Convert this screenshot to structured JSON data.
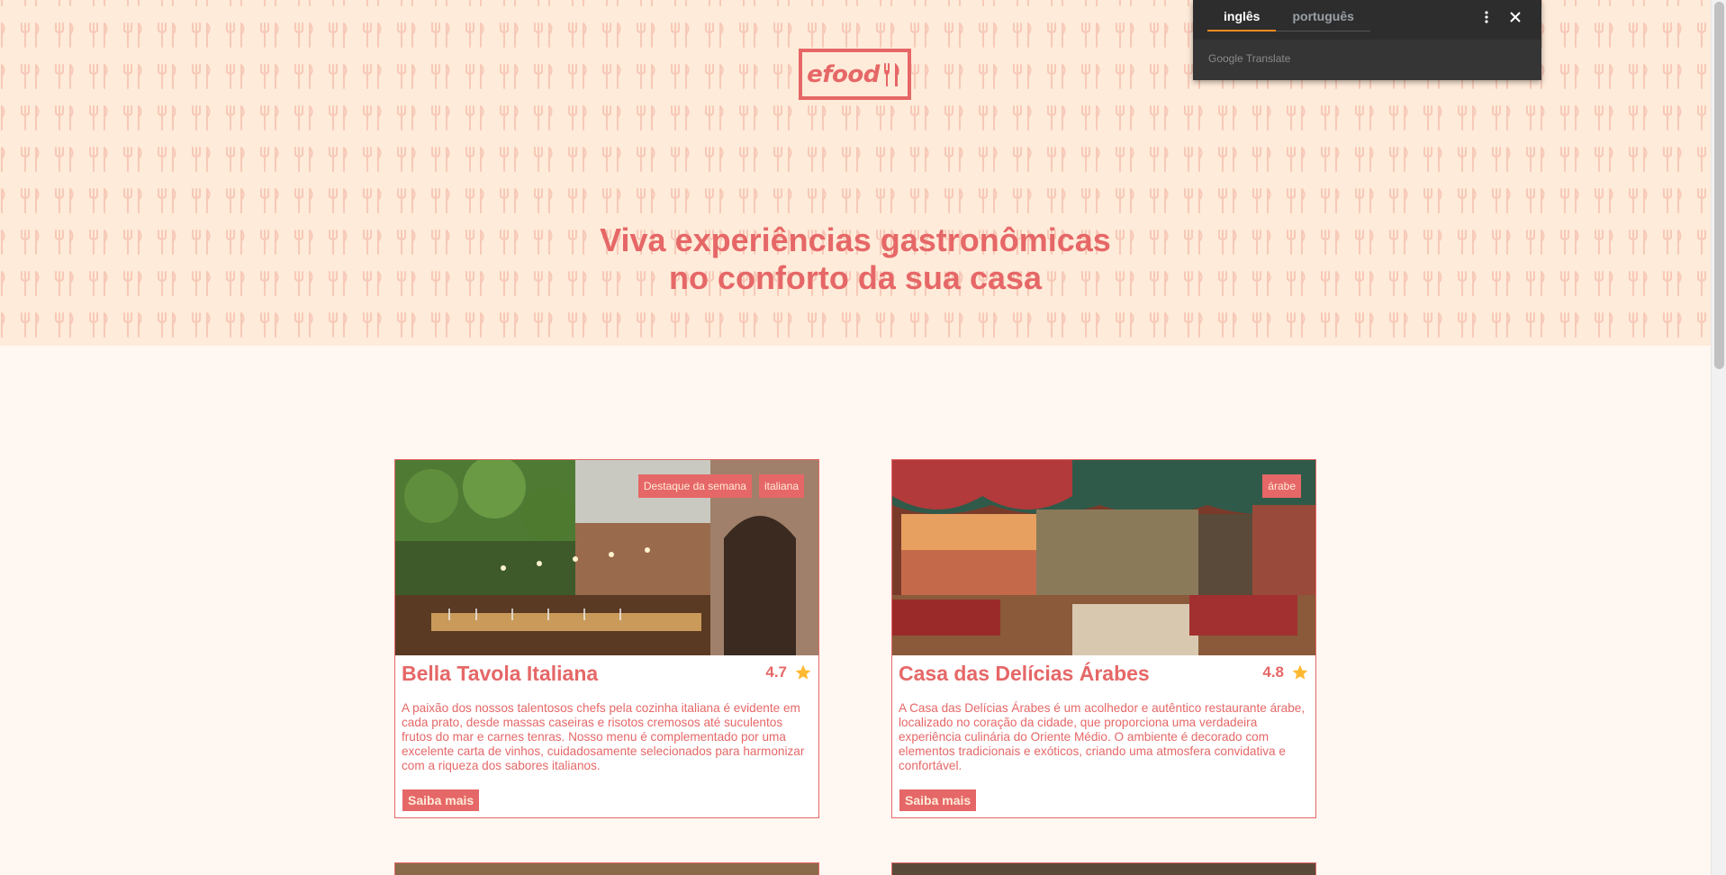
{
  "brand": {
    "logo_text": "efood"
  },
  "hero": {
    "line1": "Viva experiências gastronômicas",
    "line2": "no conforto da sua casa"
  },
  "colors": {
    "primary": "#e66767",
    "hero_bg": "#ffebd9",
    "page_bg": "#fff8f2",
    "star": "#ffb930"
  },
  "restaurants": [
    {
      "name": "Bella Tavola Italiana",
      "rating": "4.7",
      "tags": [
        "Destaque da semana",
        "italiana"
      ],
      "description": "A paixão dos nossos talentosos chefs pela cozinha italiana é evidente em cada prato, desde massas caseiras e risotos cremosos até suculentos frutos do mar e carnes tenras. Nosso menu é complementado por uma excelente carta de vinhos, cuidadosamente selecionados para harmonizar com a riqueza dos sabores italianos.",
      "button": "Saiba mais"
    },
    {
      "name": "Casa das Delícias Árabes",
      "rating": "4.8",
      "tags": [
        "árabe"
      ],
      "description": "A Casa das Delícias Árabes é um acolhedor e autêntico restaurante árabe, localizado no coração da cidade, que proporciona uma verdadeira experiência culinária do Oriente Médio. O ambiente é decorado com elementos tradicionais e exóticos, criando uma atmosfera convidativa e confortável.",
      "button": "Saiba mais"
    }
  ],
  "translate": {
    "tabs": [
      "inglês",
      "português"
    ],
    "active_tab": "inglês",
    "brand": "Google Translate",
    "icons": [
      "more-vert-icon",
      "close-icon"
    ]
  }
}
